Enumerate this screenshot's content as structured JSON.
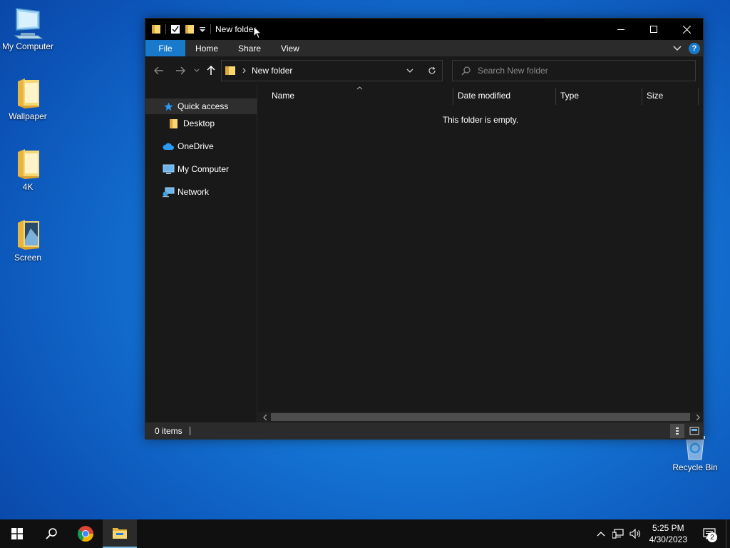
{
  "desktop": {
    "icons": [
      {
        "label": "My Computer",
        "icon": "computer-icon"
      },
      {
        "label": "Wallpaper",
        "icon": "folder-icon"
      },
      {
        "label": "4K",
        "icon": "folder-icon"
      },
      {
        "label": "Screen",
        "icon": "folder-icon"
      }
    ],
    "recycle_bin": {
      "label": "Recycle Bin",
      "icon": "recycle-bin-icon"
    }
  },
  "window": {
    "title": "New folder",
    "ribbon_tabs": [
      "File",
      "Home",
      "Share",
      "View"
    ],
    "help_label": "?",
    "address": {
      "crumb": "New folder"
    },
    "search": {
      "placeholder": "Search New folder"
    },
    "nav_pane": [
      {
        "label": "Quick access",
        "icon": "star-icon",
        "selected": true
      },
      {
        "label": "Desktop",
        "icon": "folder-icon"
      },
      {
        "label": "OneDrive",
        "icon": "cloud-icon"
      },
      {
        "label": "My Computer",
        "icon": "computer-icon"
      },
      {
        "label": "Network",
        "icon": "network-icon"
      }
    ],
    "columns": [
      "Name",
      "Date modified",
      "Type",
      "Size"
    ],
    "empty_message": "This folder is empty.",
    "status": {
      "items": "0 items"
    }
  },
  "taskbar": {
    "apps": [
      "start-icon",
      "search-icon",
      "chrome-icon",
      "file-explorer-icon"
    ],
    "clock": {
      "time": "5:25 PM",
      "date": "4/30/2023"
    },
    "notification_count": "2"
  },
  "colors": {
    "accent": "#1979ca",
    "window_bg": "#191919",
    "titlebar_bg": "#000000",
    "taskbar_bg": "#101010"
  }
}
